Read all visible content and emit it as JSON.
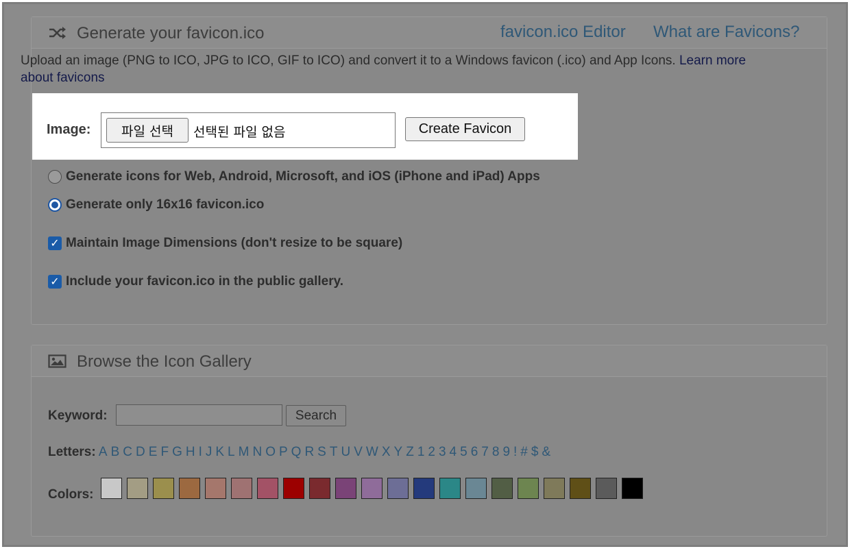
{
  "generate_panel": {
    "title": "Generate your favicon.ico",
    "icon": "shuffle-icon",
    "links": [
      "favicon.ico Editor",
      "What are Favicons?"
    ],
    "intro_text": "Upload an image (PNG to ICO, JPG to ICO, GIF to ICO) and convert it to a Windows favicon (.ico) and App Icons. ",
    "intro_link": "Learn more about favicons",
    "image_label": "Image:",
    "file_button": "파일 선택",
    "file_status": "선택된 파일 없음",
    "create_button": "Create Favicon",
    "options": {
      "radio_all": "Generate icons for Web, Android, Microsoft, and iOS (iPhone and iPad) Apps",
      "radio_16": "Generate only 16x16 favicon.ico",
      "selected": "radio_16",
      "chk_dimensions": "Maintain Image Dimensions (don't resize to be square)",
      "chk_gallery": "Include your favicon.ico in the public gallery."
    }
  },
  "gallery_panel": {
    "title": "Browse the Icon Gallery",
    "icon": "image-icon",
    "keyword_label": "Keyword:",
    "keyword_value": "",
    "search_button": "Search",
    "letters_label": "Letters:",
    "letters": [
      "A",
      "B",
      "C",
      "D",
      "E",
      "F",
      "G",
      "H",
      "I",
      "J",
      "K",
      "L",
      "M",
      "N",
      "O",
      "P",
      "Q",
      "R",
      "S",
      "T",
      "U",
      "V",
      "W",
      "X",
      "Y",
      "Z",
      "1",
      "2",
      "3",
      "4",
      "5",
      "6",
      "7",
      "8",
      "9",
      "!",
      "#",
      "$",
      "&"
    ],
    "colors_label": "Colors:",
    "colors": [
      "#c8c8c8",
      "#a39d84",
      "#9b8f4d",
      "#9c6940",
      "#a5776c",
      "#9f7272",
      "#a35266",
      "#9c0000",
      "#7a2a2e",
      "#7a4377",
      "#8f6c9a",
      "#6d6e96",
      "#243a7c",
      "#2b8787",
      "#6a8794",
      "#525e45",
      "#6d8550",
      "#7f7a5a",
      "#5f4f17",
      "#5b5b5b",
      "#000000"
    ]
  }
}
